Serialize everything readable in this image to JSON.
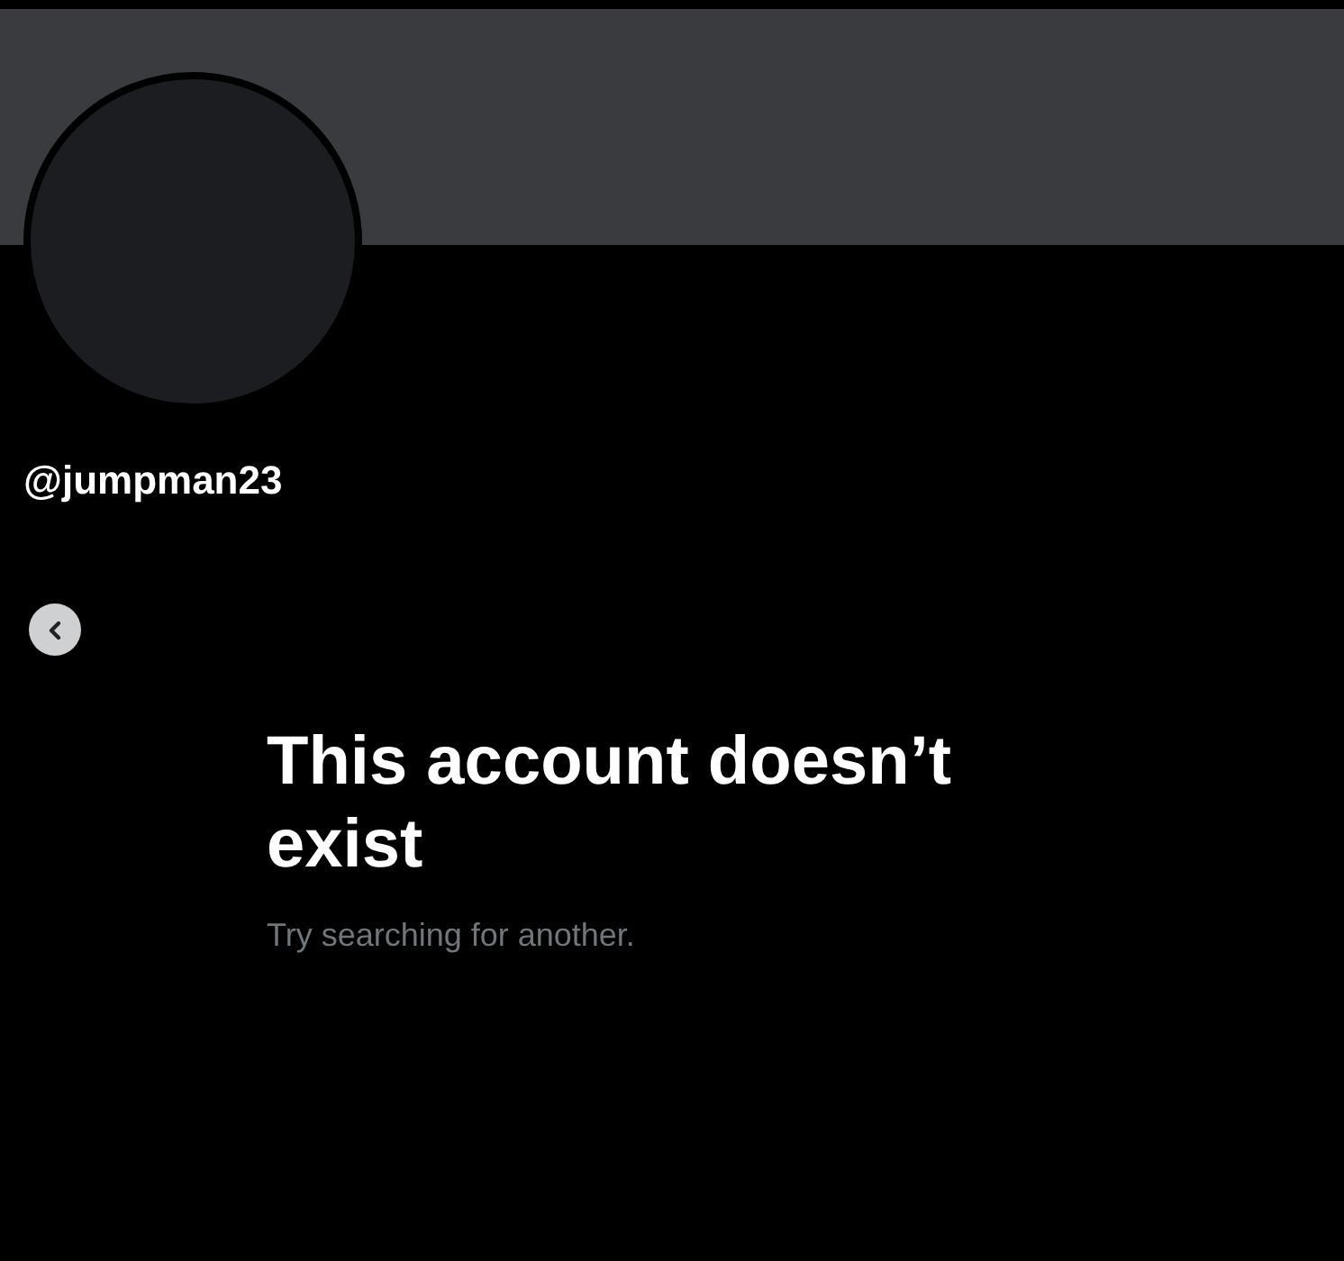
{
  "profile": {
    "handle": "@jumpman23"
  },
  "empty_state": {
    "title": "This account doesn’t exist",
    "subtitle": "Try searching for another."
  }
}
